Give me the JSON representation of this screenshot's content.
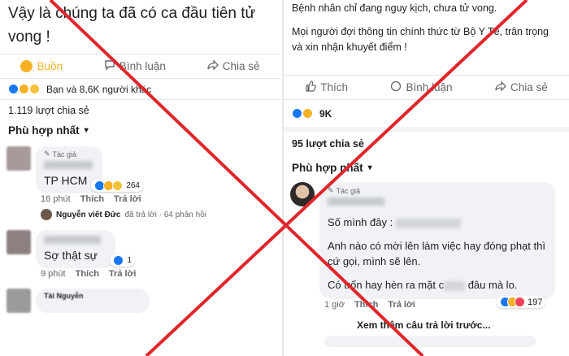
{
  "left": {
    "post_text": "Vậy là chúng ta đã có ca đầu tiên tử vong !",
    "actions": {
      "react": "Buồn",
      "comment": "Bình luận",
      "share": "Chia sẻ"
    },
    "reactions_text": "Bạn và 8,6K người khác",
    "shares": "1.119 lượt chia sẻ",
    "sort": "Phù hợp nhất",
    "comments": [
      {
        "author_tag": "Tác giả",
        "text": "TP HCM",
        "time": "16 phút",
        "like": "Thích",
        "reply": "Trả lời",
        "reactions": "264"
      },
      {
        "author_tag": "",
        "text": "Sợ thật sự",
        "time": "9 phút",
        "like": "Thích",
        "reply": "Trả lời",
        "reactions": "1"
      },
      {
        "author_tag": "Tài Nguyễn",
        "text": "",
        "time": "",
        "like": "",
        "reply": "",
        "reactions": ""
      }
    ],
    "reply_summary": {
      "name": "Nguyễn viết Đức",
      "text": "đã trả lời · 64 phản hồi"
    }
  },
  "right": {
    "post_text_1": "Bệnh nhân chỉ đang nguy kịch, chưa tử vong.",
    "post_text_2": "Mọi người đợi thông tin chính thức từ Bộ Y Tế, trân trọng và xin nhận khuyết điểm !",
    "actions": {
      "react": "Thích",
      "comment": "Bình luận",
      "share": "Chia sẻ"
    },
    "reactions_text": "9K",
    "shares": "95 lượt chia sẻ",
    "sort": "Phù hợp nhất",
    "comment": {
      "author_tag": "Tác giả",
      "line1": "Số mình đây :",
      "line2": "Anh nào có mời lên làm việc hay đóng phạt thì cứ gọi, mình sẽ lên.",
      "line3a": "Có trốn hay hèn ra mặt c",
      "line3b": "đâu mà lo.",
      "time": "1 giờ",
      "like": "Thích",
      "reply": "Trả lời",
      "reactions": "197"
    },
    "more_replies": "Xem thêm câu trả lời trước..."
  },
  "colors": {
    "cross": "#e0262b",
    "link": "#1877f2",
    "muted": "#65676b"
  }
}
